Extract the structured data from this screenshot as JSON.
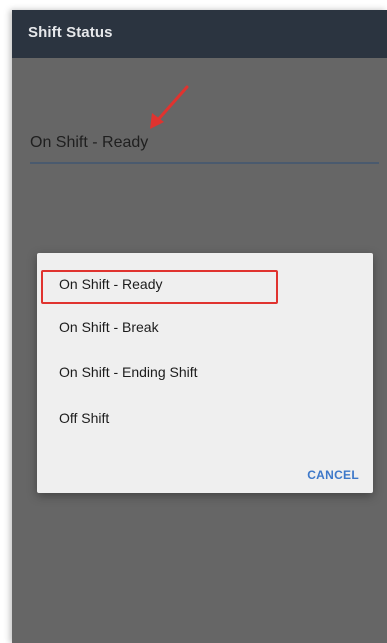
{
  "app_bar": {
    "title": "Shift Status"
  },
  "status_field": {
    "value": "On Shift - Ready"
  },
  "dialog": {
    "options": [
      {
        "label": "On Shift - Ready",
        "highlighted": true
      },
      {
        "label": "On Shift - Break",
        "highlighted": false
      },
      {
        "label": "On Shift - Ending Shift",
        "highlighted": false
      },
      {
        "label": "Off Shift",
        "highlighted": false
      }
    ],
    "cancel_label": "CANCEL"
  },
  "colors": {
    "app_bar": "#2b3440",
    "overlay": "#666666",
    "dialog_bg": "#efefef",
    "highlight_border": "#e0332f",
    "annotation_arrow": "#e0332f",
    "cancel_text": "#3d78c9"
  }
}
